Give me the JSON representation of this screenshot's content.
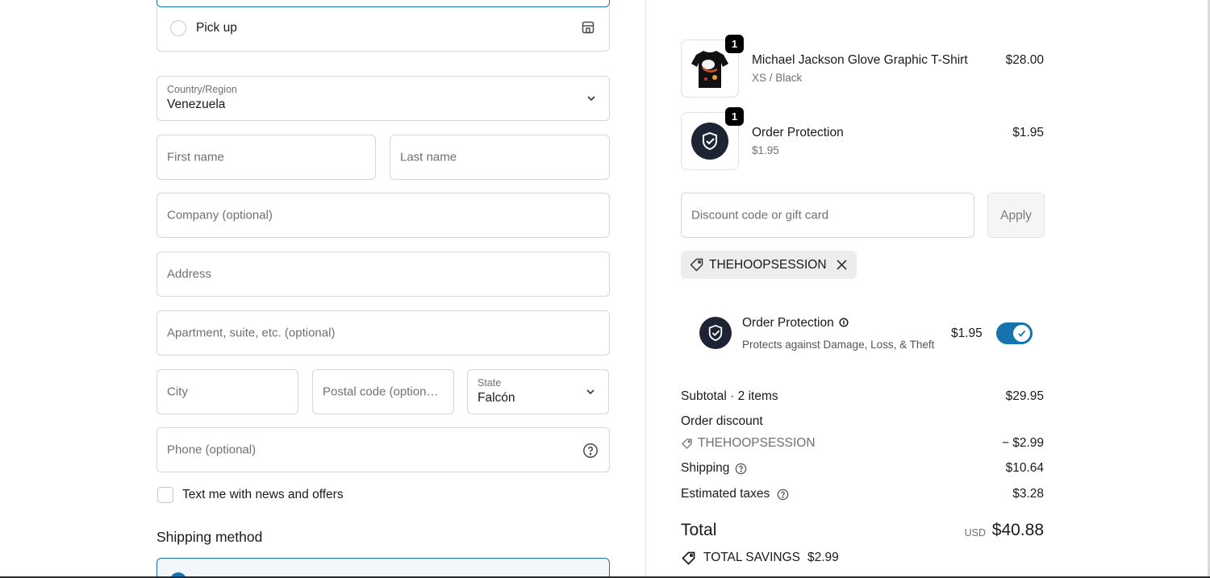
{
  "delivery": {
    "pickup_label": "Pick up"
  },
  "address": {
    "country_label": "Country/Region",
    "country_value": "Venezuela",
    "first_name_placeholder": "First name",
    "last_name_placeholder": "Last name",
    "company_placeholder": "Company (optional)",
    "address_placeholder": "Address",
    "apartment_placeholder": "Apartment, suite, etc. (optional)",
    "city_placeholder": "City",
    "postal_placeholder": "Postal code (option…",
    "state_label": "State",
    "state_value": "Falcón",
    "phone_placeholder": "Phone (optional)",
    "text_me_label": "Text me with news and offers"
  },
  "shipping": {
    "heading": "Shipping method"
  },
  "summary": {
    "items": [
      {
        "name": "Michael Jackson Glove Graphic T-Shirt",
        "variant": "XS / Black",
        "price": "$28.00",
        "quantity": "1"
      },
      {
        "name": "Order Protection",
        "variant": "$1.95",
        "price": "$1.95",
        "quantity": "1"
      }
    ],
    "discount_placeholder": "Discount code or gift card",
    "apply_label": "Apply",
    "applied_code": "THEHOOPSESSION",
    "protection": {
      "title": "Order Protection",
      "subtitle": "Protects against Damage, Loss, & Theft",
      "price": "$1.95",
      "enabled": true
    },
    "subtotal_label": "Subtotal · 2 items",
    "subtotal_value": "$29.95",
    "order_discount_label": "Order discount",
    "discount_code": "THEHOOPSESSION",
    "discount_value": "− $2.99",
    "shipping_label": "Shipping",
    "shipping_value": "$10.64",
    "taxes_label": "Estimated taxes",
    "taxes_value": "$3.28",
    "total_label": "Total",
    "currency": "USD",
    "total_value": "$40.88",
    "savings_label": "TOTAL SAVINGS",
    "savings_value": "$2.99"
  },
  "colors": {
    "accent": "#1773b0",
    "border": "#d6d6d6",
    "placeholder": "#707070"
  }
}
